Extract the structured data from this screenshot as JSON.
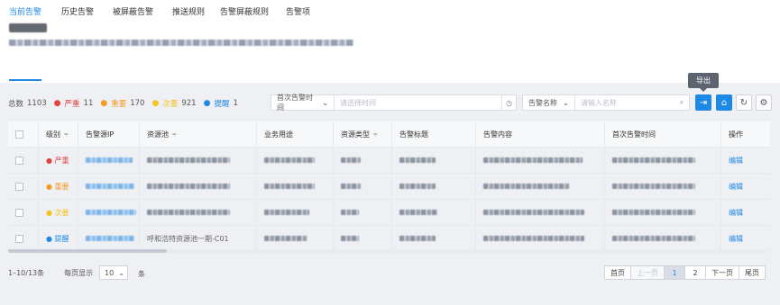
{
  "tabs": [
    {
      "label": "当前告警",
      "active": true
    },
    {
      "label": "历史告警",
      "active": false
    },
    {
      "label": "被屏蔽告警",
      "active": false
    },
    {
      "label": "推送规则",
      "active": false
    },
    {
      "label": "告警屏蔽规则",
      "active": false
    },
    {
      "label": "告警项",
      "active": false
    }
  ],
  "summary": {
    "total_label": "总数",
    "total": "1103",
    "critical_label": "严重",
    "critical": "11",
    "major_label": "重要",
    "major": "170",
    "minor_label": "次要",
    "minor": "921",
    "info_label": "提醒",
    "info": "1"
  },
  "colors": {
    "accent": "#1e89e5",
    "critical": "#e0453d",
    "major": "#f59a23",
    "minor": "#f7c221",
    "info": "#1e89e5"
  },
  "filters": {
    "time_select": "首次告警时间",
    "time_placeholder": "请选择时间",
    "name_select": "告警名称",
    "name_placeholder": "请输入名称"
  },
  "toolbar": {
    "export_tooltip": "导出"
  },
  "columns": [
    "级别",
    "告警源IP",
    "资源池",
    "业务用途",
    "资源类型",
    "告警标题",
    "告警内容",
    "首次告警时间",
    "操作"
  ],
  "rows": [
    {
      "level": "严重",
      "level_color": "#e0453d",
      "pool_visible": "",
      "action": "编辑"
    },
    {
      "level": "重要",
      "level_color": "#f59a23",
      "pool_visible": "",
      "action": "编辑"
    },
    {
      "level": "次要",
      "level_color": "#f7c221",
      "pool_visible": "",
      "action": "编辑"
    },
    {
      "level": "提醒",
      "level_color": "#1e89e5",
      "pool_visible": "呼和浩特资源池一期-C01",
      "action": "编辑"
    }
  ],
  "pagination": {
    "range": "1–10/13条",
    "per_page_label": "每页显示",
    "per_page": "10",
    "unit": "条",
    "first": "首页",
    "prev": "上一页",
    "p1": "1",
    "p2": "2",
    "next": "下一页",
    "last": "尾页"
  }
}
